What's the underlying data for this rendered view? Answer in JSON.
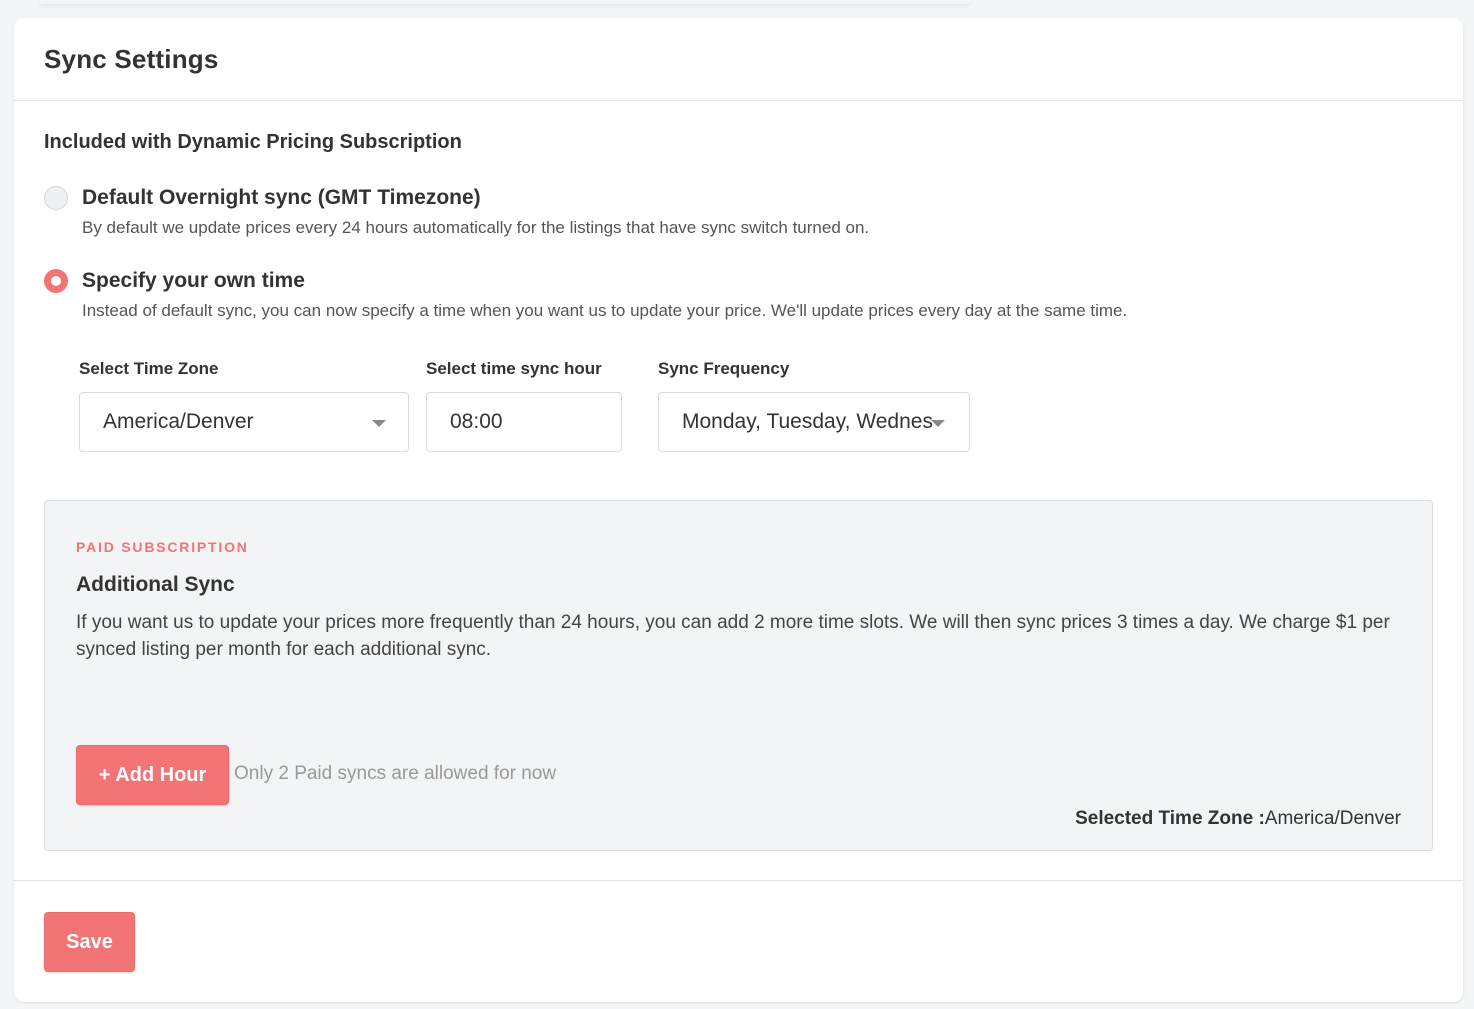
{
  "header": {
    "title": "Sync Settings"
  },
  "included": {
    "heading": "Included with Dynamic Pricing Subscription",
    "options": [
      {
        "label": "Default Overnight sync (GMT Timezone)",
        "description": "By default we update prices every 24 hours automatically for the listings that have sync switch turned on.",
        "selected": false
      },
      {
        "label": "Specify your own time",
        "description": "Instead of default sync, you can now specify a time when you want us to update your price. We'll update prices every day at the same time.",
        "selected": true
      }
    ]
  },
  "fields": {
    "timezone": {
      "label": "Select Time Zone",
      "value": "America/Denver"
    },
    "sync_hour": {
      "label": "Select time sync hour",
      "value": "08:00"
    },
    "frequency": {
      "label": "Sync Frequency",
      "value": "Monday, Tuesday, Wednes"
    }
  },
  "paid": {
    "tag": "PAID SUBSCRIPTION",
    "title": "Additional Sync",
    "description": "If you want us to update your prices more frequently than 24 hours, you can add 2 more time slots. We will then sync prices 3 times a day. We charge $1 per synced listing per month for each additional sync.",
    "add_button": "+ Add Hour",
    "note": "Only 2 Paid syncs are allowed for now",
    "tz_label": "Selected Time Zone :",
    "tz_value": "America/Denver"
  },
  "footer": {
    "save_label": "Save"
  },
  "colors": {
    "accent": "#f27474",
    "background": "#f4f5f7"
  }
}
